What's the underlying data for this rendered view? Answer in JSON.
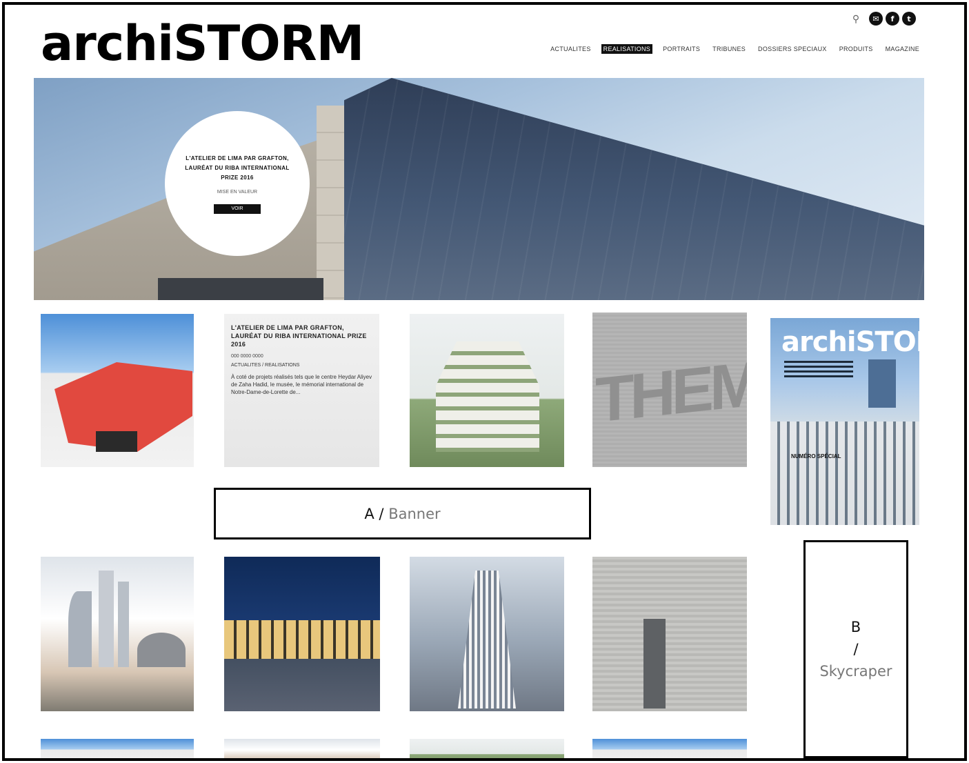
{
  "header": {
    "logo_text": "archiSTORM",
    "nav": [
      {
        "label": "ACTUALITES",
        "active": false
      },
      {
        "label": "REALISATIONS",
        "active": true
      },
      {
        "label": "PORTRAITS",
        "active": false
      },
      {
        "label": "TRIBUNES",
        "active": false
      },
      {
        "label": "DOSSIERS SPECIAUX",
        "active": false
      },
      {
        "label": "PRODUITS",
        "active": false
      },
      {
        "label": "MAGAZINE",
        "active": false
      }
    ],
    "icons": [
      "search-icon",
      "envelope-icon",
      "facebook-icon",
      "twitter-icon"
    ]
  },
  "hero": {
    "title": "L'ATELIER DE LIMA PAR GRAFTON, LAURÉAT DU RIBA INTERNATIONAL PRIZE 2016",
    "subtitle": "MISE EN VALEUR",
    "button": "VOIR"
  },
  "article": {
    "title": "L'ATELIER DE LIMA PAR GRAFTON, LAURÉAT DU RIBA INTERNATIONAL PRIZE 2016",
    "date": "000 0000 0000",
    "category": "ACTUALITES / REALISATIONS",
    "excerpt": "À coté de projets réalisés tels que le centre Heydar Aliyev de Zaha Hadid, le musée, le mémorial international de Notre-Dame-de-Lorette de..."
  },
  "tile_text": {
    "them": "THEMO"
  },
  "magazine": {
    "title": "archiSTORM",
    "special": "NUMÉRO SPÉCIAL"
  },
  "ads": {
    "a_letter": "A",
    "a_sep": "/",
    "a_name": "Banner",
    "b_letter": "B",
    "b_sep": "/",
    "b_name": "Skycraper"
  },
  "colors": {
    "accent": "#111111",
    "hero_sky": "#a8c2dd",
    "red_building": "#e1493f"
  }
}
